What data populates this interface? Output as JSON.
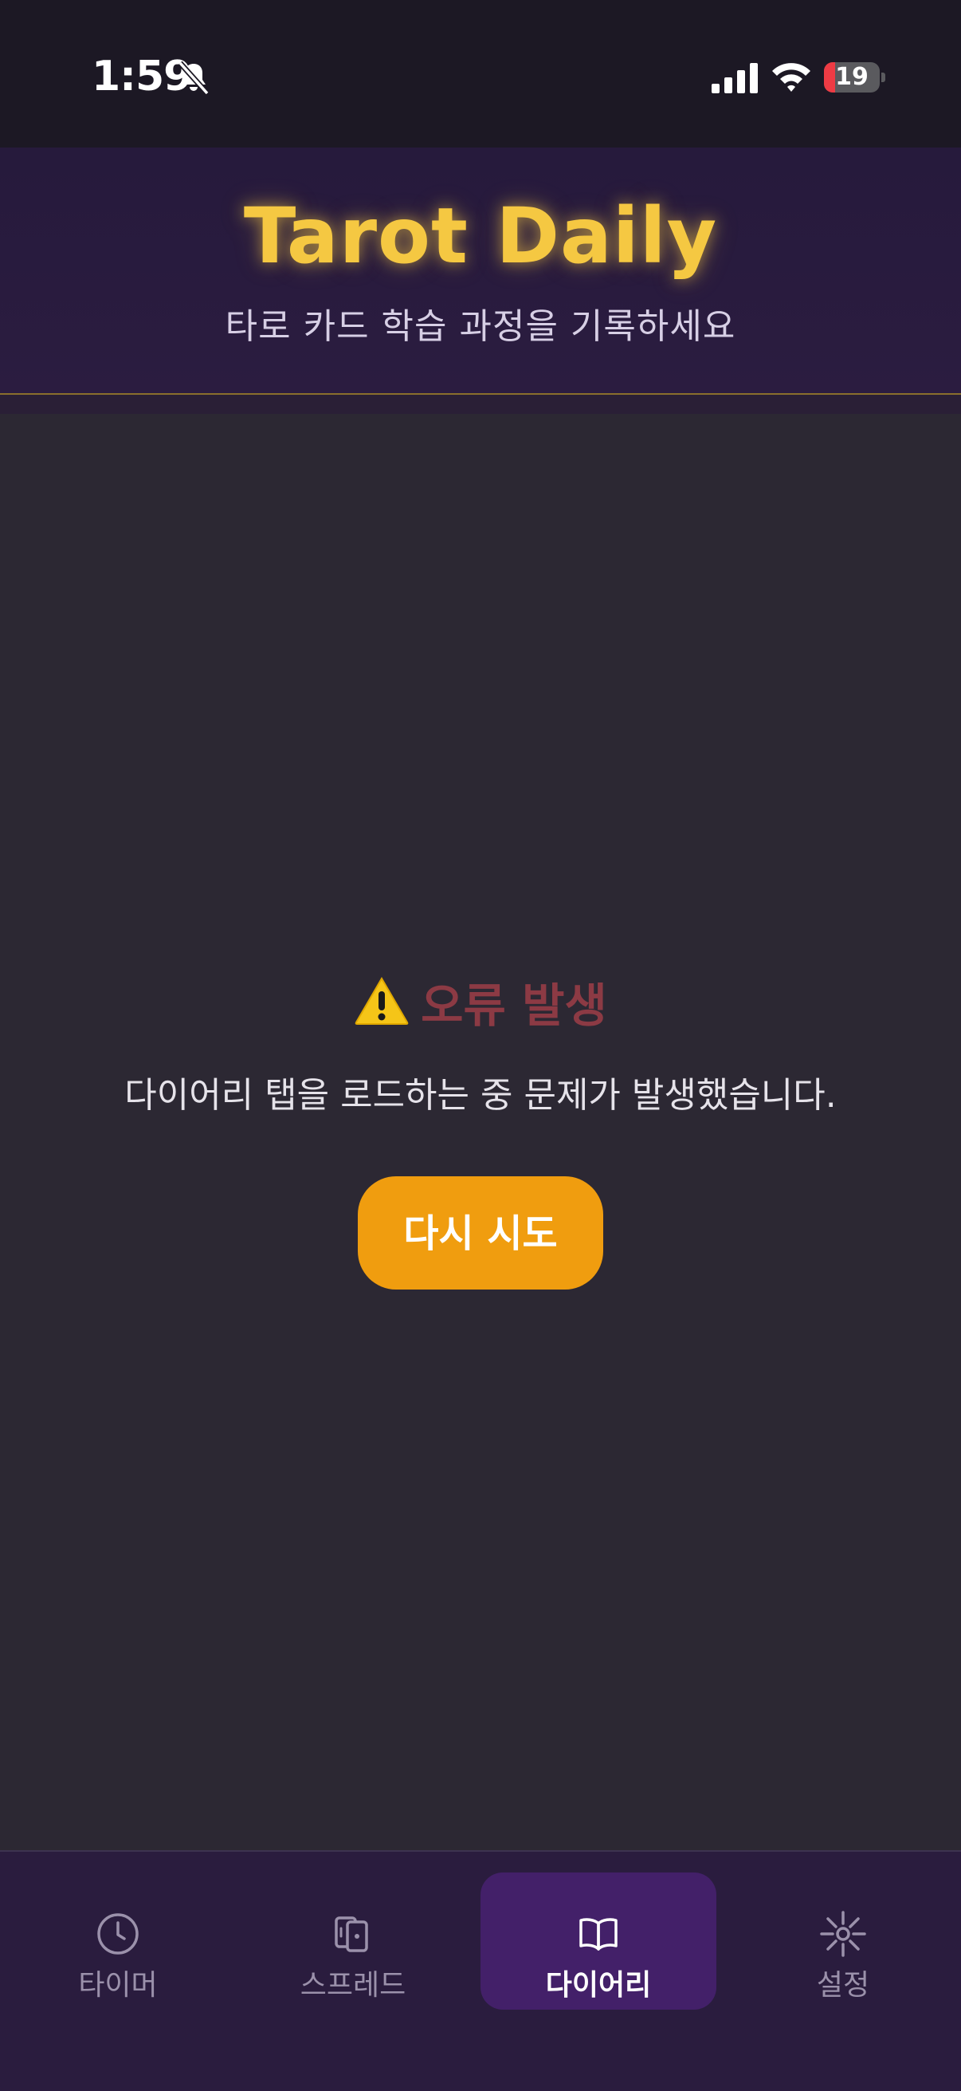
{
  "status_bar": {
    "time": "1:59",
    "battery_level": "19",
    "icons": [
      "bell-slash-icon",
      "signal-icon",
      "wifi-icon",
      "battery-icon"
    ]
  },
  "header": {
    "title": "Tarot Daily",
    "subtitle": "타로 카드 학습 과정을 기록하세요"
  },
  "error": {
    "icon": "warning-icon",
    "title": "오류 발생",
    "message": "다이어리 탭을 로드하는 중 문제가 발생했습니다.",
    "retry_label": "다시 시도"
  },
  "tabs": [
    {
      "label": "타이머",
      "icon": "clock-icon",
      "active": false
    },
    {
      "label": "스프레드",
      "icon": "cards-icon",
      "active": false
    },
    {
      "label": "다이어리",
      "icon": "book-open-icon",
      "active": true
    },
    {
      "label": "설정",
      "icon": "sun-icon",
      "active": false
    }
  ],
  "colors": {
    "accent_gold": "#f5c842",
    "button_orange": "#f09d0f",
    "error_red": "#8c3a44",
    "active_tab": "#432069",
    "background": "#2c2833"
  }
}
